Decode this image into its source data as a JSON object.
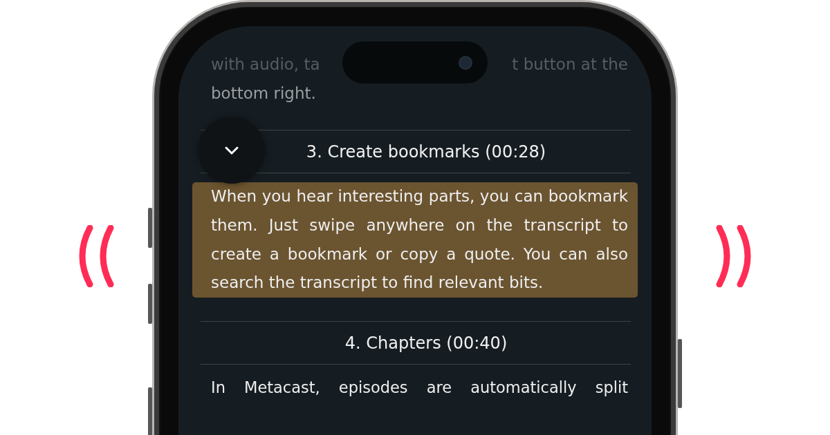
{
  "intro": {
    "line_1_left": "with audio, ta",
    "line_1_right": "t button at the",
    "line_2": "bottom right."
  },
  "chapters": [
    {
      "title": "3. Create bookmarks (00:28)",
      "body": "When you hear interesting parts, you can bookmark them. Just swipe anywhere on the transcript to create a bookmark or copy a quote. You can also search the transcript to find relevant bits.",
      "highlighted": true
    },
    {
      "title": "4. Chapters (00:40)",
      "body": "In Metacast, episodes are automatically split",
      "highlighted": false
    }
  ]
}
